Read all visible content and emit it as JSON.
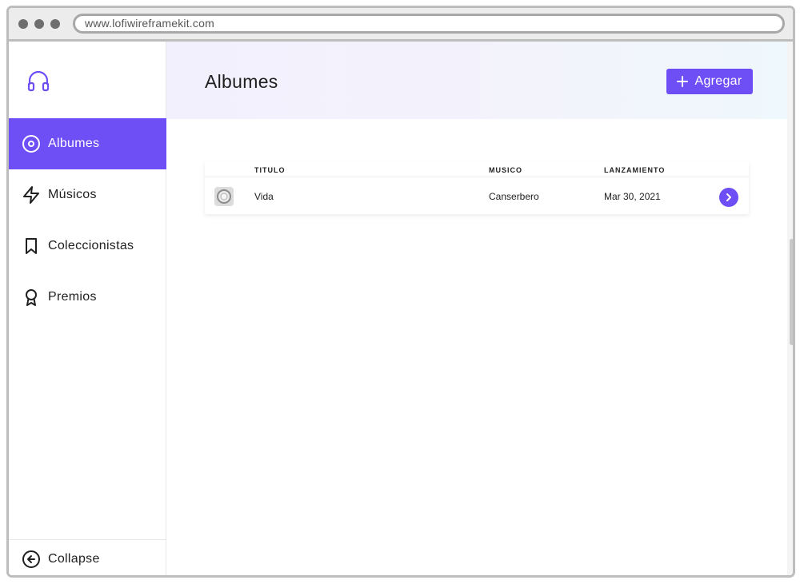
{
  "browser": {
    "url": "www.lofiwireframekit.com"
  },
  "sidebar": {
    "logo_icon": "headphones-icon",
    "items": [
      {
        "label": "Albumes",
        "icon": "disc-icon",
        "active": true
      },
      {
        "label": "Músicos",
        "icon": "lightning-icon",
        "active": false
      },
      {
        "label": "Coleccionistas",
        "icon": "bookmark-icon",
        "active": false
      },
      {
        "label": "Premios",
        "icon": "award-icon",
        "active": false
      }
    ],
    "collapse_label": "Collapse"
  },
  "header": {
    "title": "Albumes",
    "add_button_label": "Agregar"
  },
  "table": {
    "columns": [
      "TITULO",
      "MUSICO",
      "LANZAMIENTO"
    ],
    "rows": [
      {
        "title": "Vida",
        "musician": "Canserbero",
        "release": "Mar 30, 2021"
      }
    ]
  },
  "colors": {
    "accent": "#6e4ff6"
  }
}
